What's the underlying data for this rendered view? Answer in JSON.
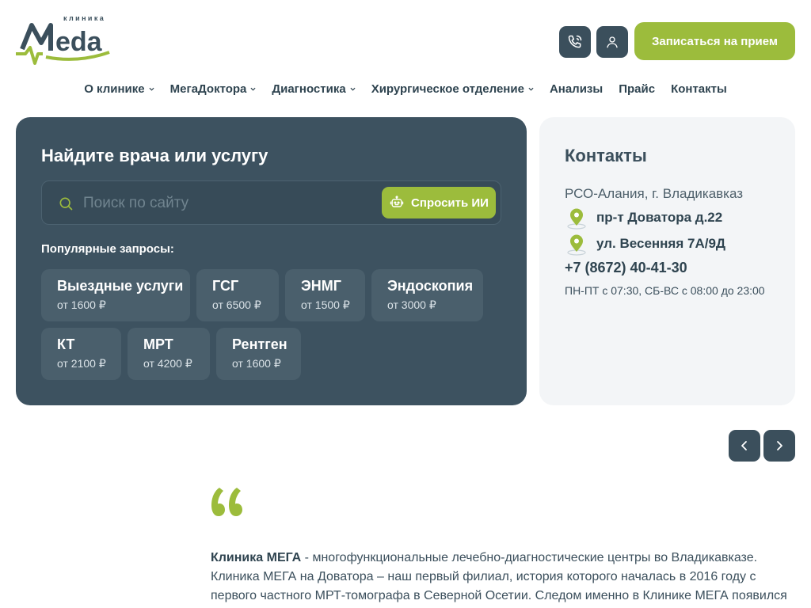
{
  "brand": {
    "logo_small": "клиника",
    "logo_word": "Mega",
    "accent": "#9cbc3c",
    "dark": "#3b4f5c"
  },
  "header": {
    "phone_icon": "phone-icon",
    "user_icon": "user-icon",
    "appointment_label": "Записаться на прием"
  },
  "nav": [
    {
      "label": "О клинике",
      "dropdown": true
    },
    {
      "label": "МегаДоктора",
      "dropdown": true
    },
    {
      "label": "Диагностика",
      "dropdown": true
    },
    {
      "label": "Хирургическое отделение",
      "dropdown": true
    },
    {
      "label": "Анализы",
      "dropdown": false
    },
    {
      "label": "Прайс",
      "dropdown": false
    },
    {
      "label": "Контакты",
      "dropdown": false
    }
  ],
  "search": {
    "title": "Найдите врача или услугу",
    "placeholder": "Поиск по сайту",
    "ask_ai_label": "Спросить ИИ",
    "popular_label": "Популярные запросы:",
    "chips": [
      {
        "name": "Выездные услуги",
        "price": "от 1600 ₽"
      },
      {
        "name": "ГСГ",
        "price": "от 6500 ₽"
      },
      {
        "name": "ЭНМГ",
        "price": "от 1500 ₽"
      },
      {
        "name": "Эндоскопия",
        "price": "от 3000 ₽"
      },
      {
        "name": "КТ",
        "price": "от 2100 ₽"
      },
      {
        "name": "МРТ",
        "price": "от 4200 ₽"
      },
      {
        "name": "Рентген",
        "price": "от 1600 ₽"
      }
    ]
  },
  "contacts": {
    "title": "Контакты",
    "city": "РСО-Алания, г. Владикавказ",
    "address1": "пр-т Доватора д.22",
    "address2": "ул. Весенняя 7А/9Д",
    "phone": "+7 (8672) 40-41-30",
    "hours": "ПН-ПТ с 07:30, СБ-ВС с 08:00 до 23:00"
  },
  "about": {
    "bold": "Клиника МЕГА",
    "text": " - многофункциональные лечебно-диагностические центры во Владикавказе. Клиника МЕГА на Доватора – наш первый филиал, история которого началась в 2016 году с первого частного МРТ-томографа в Северной Осетии. Следом именно в Клинике МЕГА появился первый в"
  }
}
